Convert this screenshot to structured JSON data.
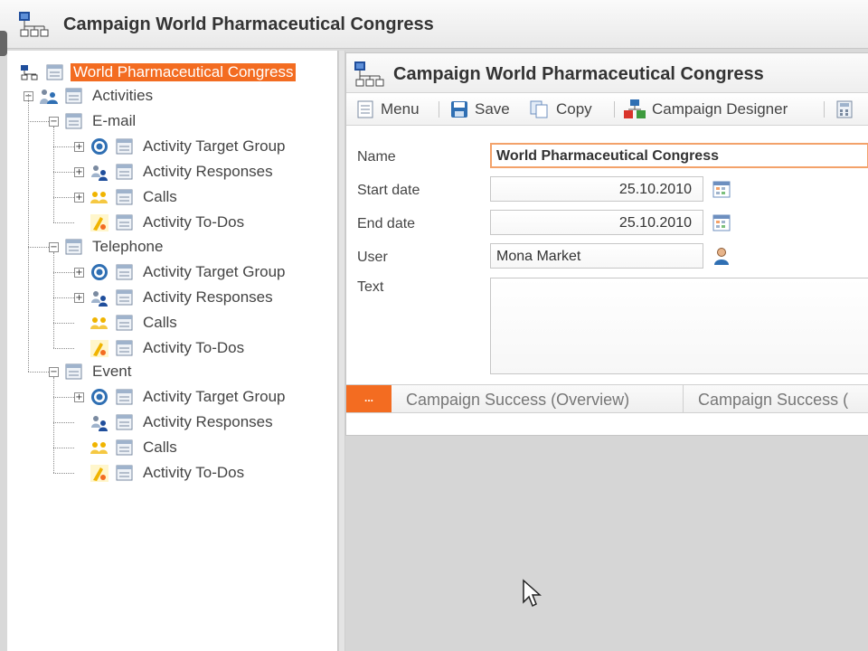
{
  "app": {
    "title": "Campaign World Pharmaceutical Congress"
  },
  "tree": {
    "root": {
      "label": "World Pharmaceutical Congress",
      "selected": true
    },
    "activities": {
      "label": "Activities"
    },
    "groups": [
      {
        "label": "E-mail",
        "items": [
          {
            "label": "Activity Target Group",
            "icon": "target-group-icon"
          },
          {
            "label": "Activity Responses",
            "icon": "responses-icon"
          },
          {
            "label": "Calls",
            "icon": "calls-icon"
          },
          {
            "label": "Activity To-Dos",
            "icon": "todo-icon"
          }
        ]
      },
      {
        "label": "Telephone",
        "items": [
          {
            "label": "Activity Target Group",
            "icon": "target-group-icon"
          },
          {
            "label": "Activity Responses",
            "icon": "responses-icon"
          },
          {
            "label": "Calls",
            "icon": "calls-icon"
          },
          {
            "label": "Activity To-Dos",
            "icon": "todo-icon"
          }
        ]
      },
      {
        "label": "Event",
        "items": [
          {
            "label": "Activity Target Group",
            "icon": "target-group-icon"
          },
          {
            "label": "Activity Responses",
            "icon": "responses-icon"
          },
          {
            "label": "Calls",
            "icon": "calls-icon"
          },
          {
            "label": "Activity To-Dos",
            "icon": "todo-icon"
          }
        ]
      }
    ]
  },
  "main": {
    "title": "Campaign World Pharmaceutical Congress",
    "toolbar": {
      "menu": "Menu",
      "save": "Save",
      "copy": "Copy",
      "designer": "Campaign Designer"
    },
    "form": {
      "name_label": "Name",
      "name_value": "World Pharmaceutical Congress",
      "start_label": "Start date",
      "start_value": "25.10.2010",
      "end_label": "End date",
      "end_value": "25.10.2010",
      "user_label": "User",
      "user_value": "Mona Market",
      "text_label": "Text",
      "text_value": ""
    },
    "tabs": {
      "more": "...",
      "items": [
        "Campaign Success (Overview)",
        "Campaign Success ("
      ]
    }
  },
  "colors": {
    "accent": "#f36c21",
    "focus_border": "#f3a26a"
  }
}
